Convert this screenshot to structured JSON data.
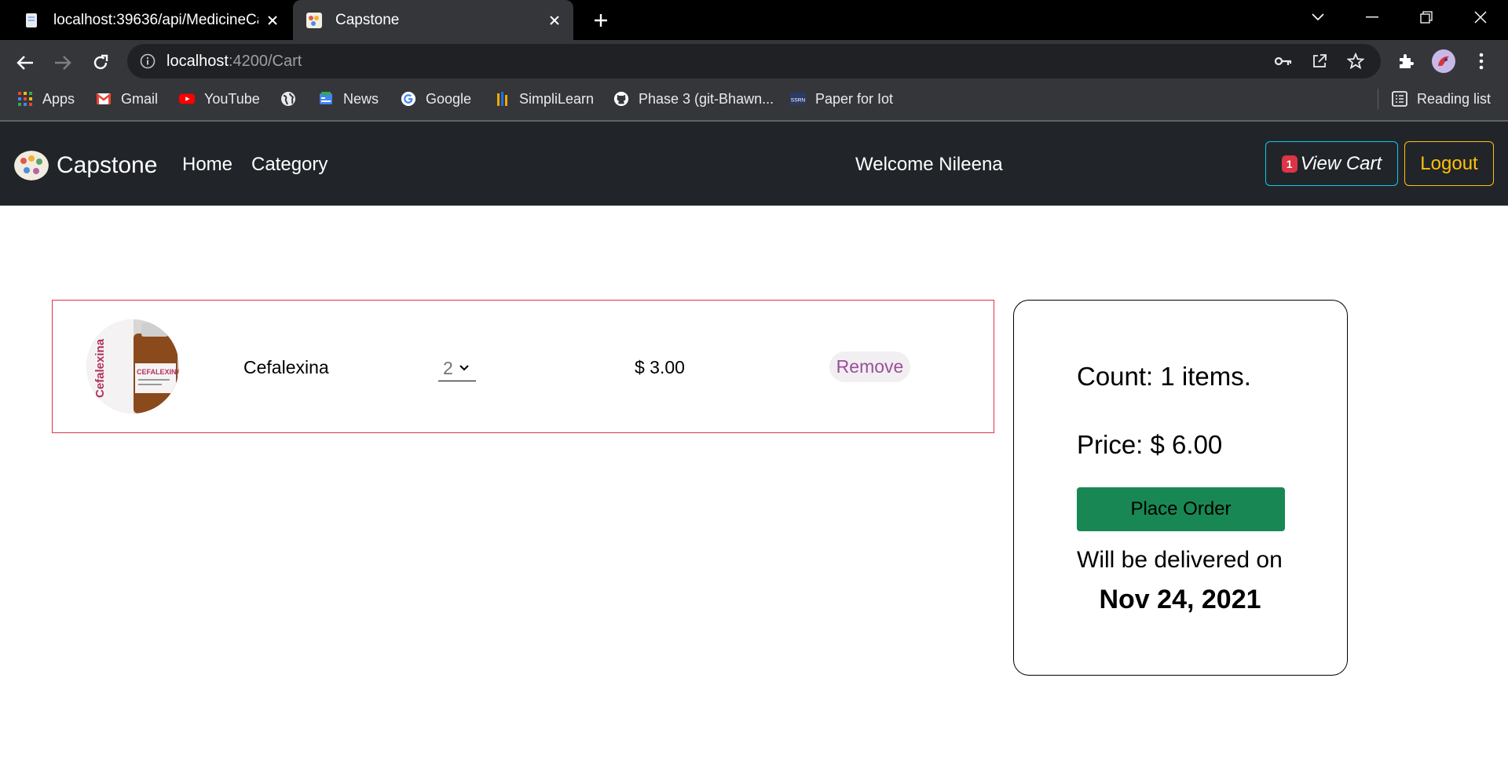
{
  "browser": {
    "tabs": [
      {
        "title": "localhost:39636/api/MedicineCat",
        "active": false
      },
      {
        "title": "Capstone",
        "active": true
      }
    ],
    "address": {
      "host": "localhost",
      "path": ":4200/Cart"
    },
    "bookmarks": [
      {
        "label": "Apps",
        "icon": "apps-grid-icon"
      },
      {
        "label": "Gmail",
        "icon": "gmail-icon"
      },
      {
        "label": "YouTube",
        "icon": "youtube-icon"
      },
      {
        "label": "",
        "icon": "globe-icon"
      },
      {
        "label": "News",
        "icon": "news-icon"
      },
      {
        "label": "Google",
        "icon": "google-icon"
      },
      {
        "label": "SimpliLearn",
        "icon": "simplilearn-icon"
      },
      {
        "label": "Phase 3 (git-Bhawn...",
        "icon": "github-icon"
      },
      {
        "label": "Paper for Iot",
        "icon": "ssrn-icon"
      }
    ],
    "reading_list": "Reading list"
  },
  "navbar": {
    "brand": "Capstone",
    "links": [
      "Home",
      "Category"
    ],
    "welcome": "Welcome Nileena",
    "cart_badge": "1",
    "cart_label": "View Cart",
    "logout_label": "Logout"
  },
  "cart": {
    "items": [
      {
        "name": "Cefalexina",
        "quantity": "2",
        "price": "$ 3.00",
        "remove_label": "Remove"
      }
    ]
  },
  "summary": {
    "count_text": "Count: 1 items.",
    "price_text": "Price: $ 6.00",
    "place_order_label": "Place Order",
    "delivery_label": "Will be delivered on",
    "delivery_date": "Nov 24, 2021"
  },
  "colors": {
    "navbar_bg": "#212529",
    "cart_button_border": "#0dcaf0",
    "logout_color": "#ffc107",
    "badge_bg": "#dc3545",
    "row_border": "#dc3545",
    "place_order_bg": "#198754",
    "remove_text": "#9b4f9a"
  }
}
